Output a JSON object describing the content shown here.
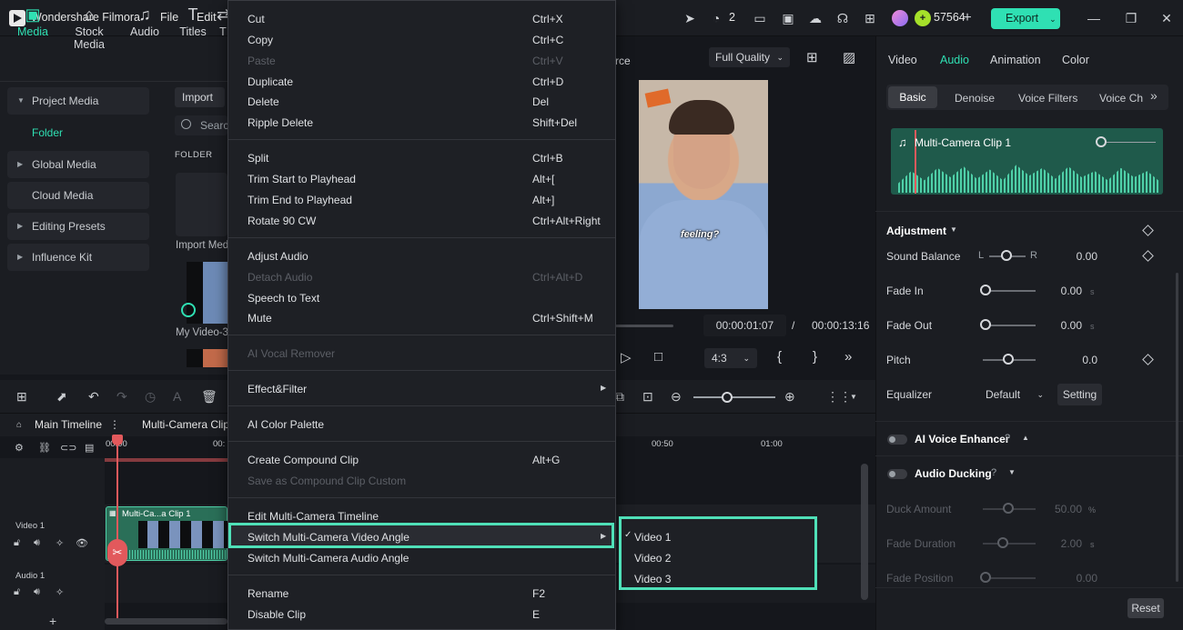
{
  "app": {
    "title": "Wondershare Filmora",
    "menu": [
      "File",
      "Edit"
    ]
  },
  "titlebar": {
    "render_count": "2",
    "credits": "57564",
    "export_label": "Export"
  },
  "media_tabs": [
    {
      "label": "Media",
      "icon": "media-icon"
    },
    {
      "label": "Stock Media",
      "icon": "stock-media-icon"
    },
    {
      "label": "Audio",
      "icon": "audio-icon"
    },
    {
      "label": "Titles",
      "icon": "titles-icon"
    },
    {
      "label": "T",
      "icon": "transitions-icon"
    }
  ],
  "sidebar": {
    "items": [
      {
        "label": "Project Media"
      },
      {
        "label": "Folder"
      },
      {
        "label": "Global Media"
      },
      {
        "label": "Cloud Media"
      },
      {
        "label": "Editing Presets"
      },
      {
        "label": "Influence Kit"
      }
    ]
  },
  "media": {
    "import_label": "Import",
    "search_placeholder": "Search",
    "folder_header": "FOLDER",
    "import_tile_label": "Import Med",
    "video_label": "My Video-3"
  },
  "preview": {
    "source_text": "rce",
    "quality": "Full Quality",
    "caption": "feeling?",
    "current_time": "00:00:01:07",
    "separator": "/",
    "total_time": "00:00:13:16",
    "ratio": "4:3"
  },
  "right_panel": {
    "tabs": [
      "Video",
      "Audio",
      "Animation",
      "Color"
    ],
    "active_tab": "Audio",
    "subtabs": [
      "Basic",
      "Denoise",
      "Voice Filters",
      "Voice Cha"
    ],
    "clip_name": "Multi-Camera Clip 1",
    "adjustment_label": "Adjustment",
    "sound_balance": {
      "label": "Sound Balance",
      "left": "L",
      "right": "R",
      "value": "0.00"
    },
    "fade_in": {
      "label": "Fade In",
      "value": "0.00",
      "unit": "s"
    },
    "fade_out": {
      "label": "Fade Out",
      "value": "0.00",
      "unit": "s"
    },
    "pitch": {
      "label": "Pitch",
      "value": "0.0"
    },
    "equalizer": {
      "label": "Equalizer",
      "value": "Default",
      "setting_label": "Setting"
    },
    "ai_voice_enhancer": "AI Voice Enhancer",
    "audio_ducking": "Audio Ducking",
    "duck_amount": {
      "label": "Duck Amount",
      "value": "50.00",
      "unit": "%"
    },
    "fade_duration": {
      "label": "Fade Duration",
      "value": "2.00",
      "unit": "s"
    },
    "fade_position": {
      "label": "Fade Position",
      "value": "0.00"
    },
    "reset_label": "Reset"
  },
  "timeline": {
    "main_tab": "Main Timeline",
    "mc_tab": "Multi-Camera Clip",
    "ticks": [
      "00:00",
      "00:",
      "00:50",
      "01:00"
    ],
    "video_track": "Video 1",
    "audio_track": "Audio 1",
    "clip_label": "Multi-Ca...a Clip 1"
  },
  "context_menu": {
    "items": [
      {
        "label": "Cut",
        "shortcut": "Ctrl+X",
        "disabled": false
      },
      {
        "label": "Copy",
        "shortcut": "Ctrl+C",
        "disabled": false
      },
      {
        "label": "Paste",
        "shortcut": "Ctrl+V",
        "disabled": true
      },
      {
        "label": "Duplicate",
        "shortcut": "Ctrl+D",
        "disabled": false
      },
      {
        "label": "Delete",
        "shortcut": "Del",
        "disabled": false
      },
      {
        "label": "Ripple Delete",
        "shortcut": "Shift+Del",
        "disabled": false
      },
      {
        "label": "Split",
        "shortcut": "Ctrl+B",
        "disabled": false
      },
      {
        "label": "Trim Start to Playhead",
        "shortcut": "Alt+[",
        "disabled": false
      },
      {
        "label": "Trim End to Playhead",
        "shortcut": "Alt+]",
        "disabled": false
      },
      {
        "label": "Rotate 90 CW",
        "shortcut": "Ctrl+Alt+Right",
        "disabled": false
      },
      {
        "label": "Adjust Audio",
        "shortcut": "",
        "disabled": false
      },
      {
        "label": "Detach Audio",
        "shortcut": "Ctrl+Alt+D",
        "disabled": true
      },
      {
        "label": "Speech to Text",
        "shortcut": "",
        "disabled": false
      },
      {
        "label": "Mute",
        "shortcut": "Ctrl+Shift+M",
        "disabled": false
      },
      {
        "label": "AI Vocal Remover",
        "shortcut": "",
        "disabled": true
      },
      {
        "label": "Effect&Filter",
        "shortcut": "",
        "disabled": false
      },
      {
        "label": "AI Color Palette",
        "shortcut": "",
        "disabled": false
      },
      {
        "label": "Create Compound Clip",
        "shortcut": "Alt+G",
        "disabled": false
      },
      {
        "label": "Save as Compound Clip Custom",
        "shortcut": "",
        "disabled": true
      },
      {
        "label": "Edit Multi-Camera Timeline",
        "shortcut": "",
        "disabled": false
      },
      {
        "label": "Switch Multi-Camera Video Angle",
        "shortcut": "",
        "disabled": false
      },
      {
        "label": "Switch Multi-Camera Audio Angle",
        "shortcut": "",
        "disabled": false
      },
      {
        "label": "Rename",
        "shortcut": "F2",
        "disabled": false
      },
      {
        "label": "Disable Clip",
        "shortcut": "E",
        "disabled": false
      }
    ],
    "submenu": [
      "Video 1",
      "Video 2",
      "Video 3"
    ],
    "checked": "Video 1"
  },
  "colors": {
    "accent": "#2fe0b3",
    "highlight_border": "#4fe0b8",
    "playhead": "#e2595c"
  }
}
